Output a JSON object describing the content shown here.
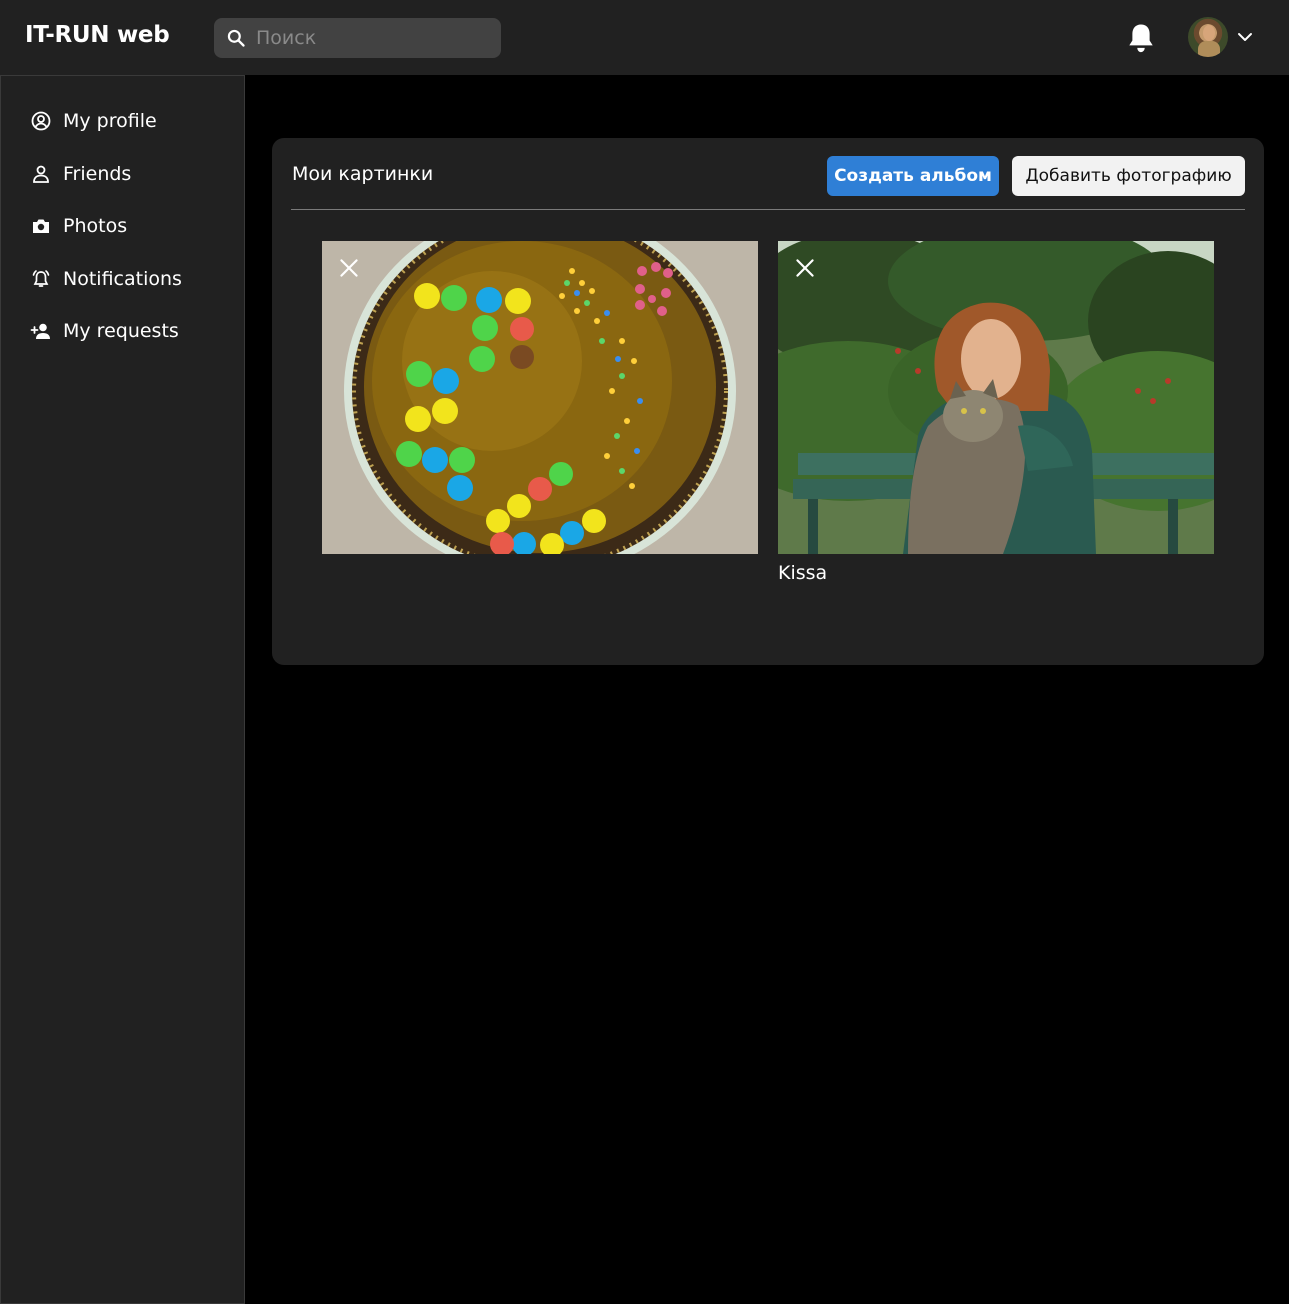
{
  "app": {
    "brand": "IT-RUN web"
  },
  "search": {
    "placeholder": "Поиск",
    "value": ""
  },
  "sidebar": {
    "items": [
      {
        "label": "My profile",
        "icon": "user-circle-icon"
      },
      {
        "label": "Friends",
        "icon": "users-icon"
      },
      {
        "label": "Photos",
        "icon": "camera-icon"
      },
      {
        "label": "Notifications",
        "icon": "bell-ring-icon"
      },
      {
        "label": "My requests",
        "icon": "user-plus-icon"
      }
    ]
  },
  "album": {
    "title": "Мои картинки",
    "create_label": "Создать альбом",
    "add_label": "Добавить фотографию",
    "photos": [
      {
        "caption": "",
        "subject": "cake with candies"
      },
      {
        "caption": "Kissa",
        "subject": "woman holding cat"
      }
    ]
  },
  "colors": {
    "background": "#000000",
    "surface": "#212121",
    "primary": "#2f7fd6",
    "search_bg": "#424242"
  }
}
